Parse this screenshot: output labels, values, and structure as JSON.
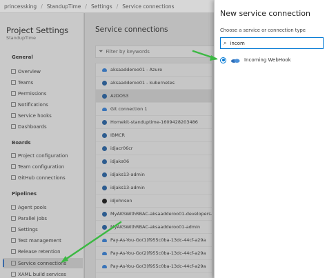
{
  "breadcrumb": {
    "items": [
      "princessking",
      "StandupTime",
      "Settings",
      "Service connections"
    ],
    "separator": "/"
  },
  "sidebar": {
    "title": "Project Settings",
    "subtitle": "StandupTime",
    "groups": {
      "general": "General",
      "boards": "Boards",
      "pipelines": "Pipelines"
    },
    "general_items": [
      {
        "label": "Overview",
        "icon": "info-icon"
      },
      {
        "label": "Teams",
        "icon": "people-icon"
      },
      {
        "label": "Permissions",
        "icon": "lock-icon"
      },
      {
        "label": "Notifications",
        "icon": "chat-icon"
      },
      {
        "label": "Service hooks",
        "icon": "hook-icon"
      },
      {
        "label": "Dashboards",
        "icon": "dashboard-icon"
      }
    ],
    "boards_items": [
      {
        "label": "Project configuration",
        "icon": "board-icon"
      },
      {
        "label": "Team configuration",
        "icon": "team-icon"
      },
      {
        "label": "GitHub connections",
        "icon": "github-icon"
      }
    ],
    "pipelines_items": [
      {
        "label": "Agent pools",
        "icon": "agent-icon"
      },
      {
        "label": "Parallel jobs",
        "icon": "parallel-icon"
      },
      {
        "label": "Settings",
        "icon": "gear-icon"
      },
      {
        "label": "Test management",
        "icon": "test-icon"
      },
      {
        "label": "Release retention",
        "icon": "phone-icon"
      },
      {
        "label": "Service connections",
        "icon": "link-icon",
        "active": true
      },
      {
        "label": "XAML build services",
        "icon": "build-icon"
      }
    ]
  },
  "main": {
    "title": "Service connections",
    "filter_placeholder": "Filter by keywords",
    "connections": [
      {
        "name": "aksaadderoo01 - Azure",
        "icon": "cloud-icon"
      },
      {
        "name": "aksaadderoo01 - kubernetes",
        "icon": "kubernetes-icon"
      },
      {
        "name": "AzDOS3",
        "icon": "azure-icon",
        "selected": true
      },
      {
        "name": "Git connection 1",
        "icon": "cloud-icon"
      },
      {
        "name": "Homekit-standuptime-1609428203486",
        "icon": "kubernetes-icon"
      },
      {
        "name": "IBMCR",
        "icon": "registry-icon"
      },
      {
        "name": "idjacr06cr",
        "icon": "registry-icon"
      },
      {
        "name": "idjaks06",
        "icon": "kubernetes-icon"
      },
      {
        "name": "idjaks13-admin",
        "icon": "kubernetes-icon"
      },
      {
        "name": "idjaks13-admin",
        "icon": "kubernetes-icon"
      },
      {
        "name": "idjohnson",
        "icon": "github-icon"
      },
      {
        "name": "MyAKSWithRBAC-aksaadderoo01-developers-",
        "icon": "kubernetes-icon"
      },
      {
        "name": "MyAKSWithRBAC-aksaadderoo01-admin",
        "icon": "kubernetes-icon"
      },
      {
        "name": "Pay-As-You-Go(1)f955c0ba-13dc-44cf-a29a",
        "icon": "cloud-icon"
      },
      {
        "name": "Pay-As-You-Go(2)f955c0ba-13dc-44cf-a29a",
        "icon": "cloud-icon"
      },
      {
        "name": "Pay-As-You-Go(3)f955c0ba-13dc-44cf-a29a",
        "icon": "cloud-icon"
      }
    ]
  },
  "panel": {
    "title": "New service connection",
    "subtitle": "Choose a service or connection type",
    "search_value": "incom",
    "option_label": "Incoming WebHook",
    "accent": "#0078d4"
  },
  "annotations": {
    "arrow_color": "#3cb843"
  }
}
